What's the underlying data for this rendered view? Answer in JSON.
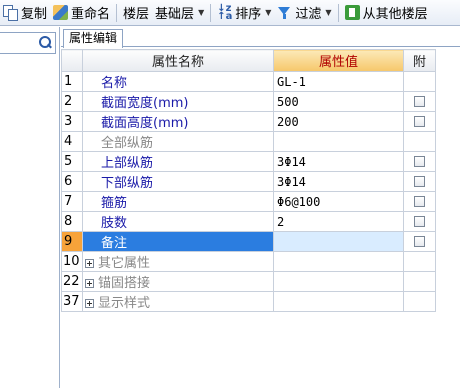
{
  "toolbar": {
    "copy_label": "复制",
    "rename_label": "重命名",
    "floor_label": "楼层",
    "floor_value": "基础层",
    "sort_label": "排序",
    "filter_label": "过滤",
    "import_label": "从其他楼层"
  },
  "search": {
    "value": ""
  },
  "tab": {
    "label": "属性编辑"
  },
  "grid": {
    "headers": {
      "name": "属性名称",
      "value": "属性值",
      "attach": "附"
    },
    "rows": [
      {
        "num": "1",
        "name": "名称",
        "value": "GL-1"
      },
      {
        "num": "2",
        "name": "截面宽度(mm)",
        "value": "500"
      },
      {
        "num": "3",
        "name": "截面高度(mm)",
        "value": "200"
      },
      {
        "num": "4",
        "name": "全部纵筋",
        "value": ""
      },
      {
        "num": "5",
        "name": "上部纵筋",
        "value": "3Φ14"
      },
      {
        "num": "6",
        "name": "下部纵筋",
        "value": "3Φ14"
      },
      {
        "num": "7",
        "name": "箍筋",
        "value": "Φ6@100"
      },
      {
        "num": "8",
        "name": "肢数",
        "value": "2"
      },
      {
        "num": "9",
        "name": "备注",
        "value": ""
      }
    ],
    "groups": [
      {
        "num": "10",
        "name": "其它属性"
      },
      {
        "num": "22",
        "name": "锚固搭接"
      },
      {
        "num": "37",
        "name": "显示样式"
      }
    ]
  },
  "colors": {
    "selected_row_number": "#f7a33a",
    "selected_row_name": "#2b7de0",
    "value_header": "#f6c76a",
    "property_name_text": "#1a1aa8"
  }
}
